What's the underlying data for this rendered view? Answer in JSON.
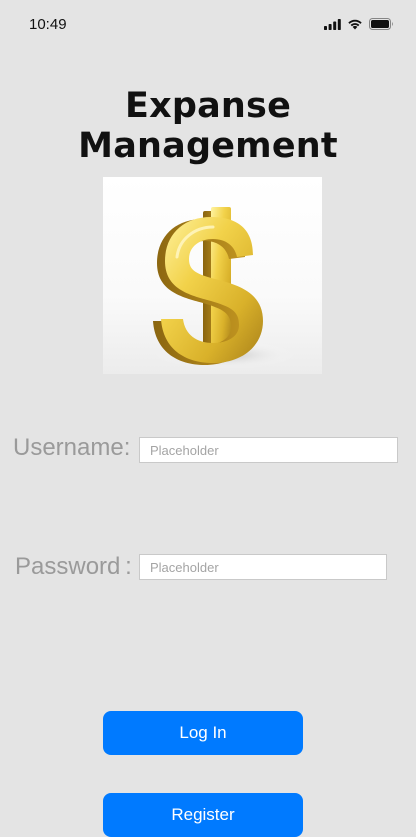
{
  "status_bar": {
    "time": "10:49",
    "icons": [
      "signal-icon",
      "wifi-icon",
      "battery-icon"
    ]
  },
  "header": {
    "title": "Expanse Management"
  },
  "logo": {
    "icon": "dollar-sign-icon",
    "color": "#d6b22a"
  },
  "form": {
    "username": {
      "label": "Username:",
      "placeholder": "Placeholder",
      "value": ""
    },
    "password": {
      "label": "Password :",
      "placeholder": "Placeholder",
      "value": ""
    }
  },
  "actions": {
    "login_label": "Log In",
    "register_label": "Register",
    "accent_color": "#007aff"
  }
}
